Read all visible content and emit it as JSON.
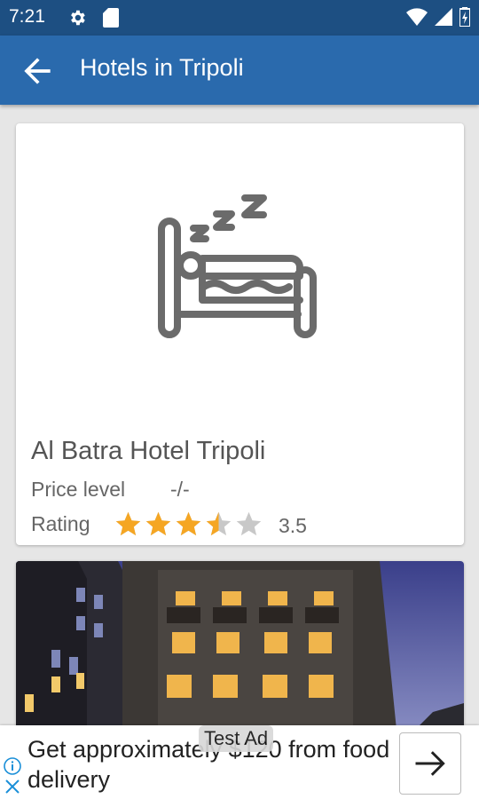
{
  "status_bar": {
    "time": "7:21",
    "icons": [
      "gear-icon",
      "sd-card-icon",
      "wifi-icon",
      "signal-icon",
      "battery-icon"
    ]
  },
  "app_bar": {
    "title": "Hotels in Tripoli",
    "back_icon": "arrow-back-icon",
    "color": "#2a6aad"
  },
  "hotels": [
    {
      "name": "Al Batra Hotel Tripoli",
      "price_label": "Price level",
      "price_value": "-/-",
      "rating_label": "Rating",
      "rating_value": "3.5",
      "rating": 3.5,
      "rating_max": 5,
      "image": "sleeping-bed-icon"
    },
    {
      "image": "hotel-building-photo"
    }
  ],
  "ad": {
    "tag": "Test Ad",
    "text": "Get approximately $120 from food delivery",
    "info_icon": "info-icon",
    "close_icon": "close-icon",
    "cta_icon": "arrow-right-icon"
  },
  "colors": {
    "star_filled": "#f5a623",
    "star_empty": "#c8c8c8",
    "status_bar": "#1d4f82"
  }
}
